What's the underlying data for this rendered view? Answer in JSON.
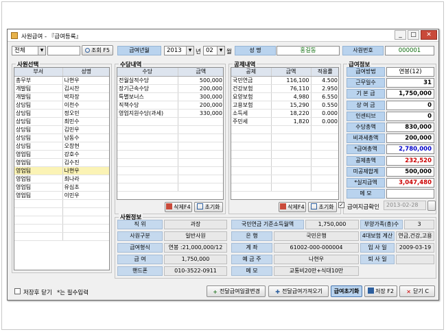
{
  "window": {
    "title": "사원급여 - 『급여등록』",
    "btn_min": "_",
    "btn_max": "□",
    "btn_close": "✕"
  },
  "toolbar": {
    "dept_combo": "전체",
    "search_text": "",
    "lookup_btn": "조회 F5",
    "ym_label": "급여년월",
    "year": "2013",
    "year_suffix": "년",
    "month": "02",
    "month_suffix": "월",
    "name_label": "성     명",
    "name_value": "홍길동",
    "empno_label": "사원번호",
    "empno_value": "000001"
  },
  "employees": {
    "title": "사원선택",
    "headers": [
      "부서",
      "성명"
    ],
    "rows": [
      [
        "총무부",
        "나현우"
      ],
      [
        "개발팀",
        "김시찬"
      ],
      [
        "개발팀",
        "박차장"
      ],
      [
        "상담팀",
        "이천수"
      ],
      [
        "상담팀",
        "정오민"
      ],
      [
        "상담팀",
        "최민수"
      ],
      [
        "상담팀",
        "김민우"
      ],
      [
        "상담팀",
        "남동수"
      ],
      [
        "상담팀",
        "오창현"
      ],
      [
        "영업팀",
        "강호수"
      ],
      [
        "영업팀",
        "김수진"
      ],
      [
        "영업팀",
        "나현우"
      ],
      [
        "영업팀",
        "최나라"
      ],
      [
        "영업팀",
        "유심초"
      ],
      [
        "영업팀",
        "이민우"
      ]
    ],
    "selected_index": 11
  },
  "allowance": {
    "title": "수당내역",
    "headers": [
      "수당",
      "금액"
    ],
    "rows": [
      [
        "전월실적수당",
        "500,000"
      ],
      [
        "장기근속수당",
        "200,000"
      ],
      [
        "특별보너스",
        "300,000"
      ],
      [
        "직책수당",
        "200,000"
      ],
      [
        "영업지원수당(과세)",
        "330,000"
      ]
    ],
    "delete_btn": "삭제F4",
    "reset_btn": "초기화"
  },
  "deduction": {
    "title": "공제내역",
    "headers": [
      "공제",
      "금액",
      "적용률"
    ],
    "rows": [
      [
        "국민연금",
        "116,100",
        "4.500"
      ],
      [
        "건강보험",
        "76,110",
        "2.950"
      ],
      [
        "요양보험",
        "4,980",
        "6.550"
      ],
      [
        "고용보험",
        "15,290",
        "0.550"
      ],
      [
        "소득세",
        "18,220",
        "0.000"
      ],
      [
        "주민세",
        "1,820",
        "0.000"
      ]
    ],
    "delete_btn": "삭제F4",
    "reset_btn": "초기화"
  },
  "pay_info": {
    "title": "급여정보",
    "items": [
      {
        "label": "급여방법",
        "value": "연봉(12)"
      },
      {
        "label": "근무일수",
        "value": "31"
      },
      {
        "label": "기 본 급",
        "value": "1,750,000"
      },
      {
        "label": "상 여 금",
        "value": "0"
      },
      {
        "label": "인센티브",
        "value": "0"
      },
      {
        "label": "수당총액",
        "value": "830,000"
      },
      {
        "label": "비과세총액",
        "value": "200,000"
      },
      {
        "label": "*급여총액",
        "value": "2,780,000"
      },
      {
        "label": "공제총액",
        "value": "232,520"
      },
      {
        "label": "미공제합계",
        "value": "500,000"
      },
      {
        "label": "*실지급액",
        "value": "3,047,480"
      },
      {
        "label": "메     모",
        "value": ""
      }
    ],
    "paid_check_label": "급여지급확인",
    "paid_date": "2013-02-28"
  },
  "employee_info": {
    "title": "사원정보",
    "position_label": "직     위",
    "position_value": "과장",
    "pension_label": "국민연금 기준소득월액",
    "pension_value": "1,750,000",
    "dependents_label": "부양가족(총)수",
    "dependents_value": "3",
    "class_label": "사원구분",
    "class_value": "일반사원",
    "bank_label": "은     행",
    "bank_value": "국민은행",
    "insurance_label": "4대보험 계산",
    "insurance_value": "연금,건강,고용",
    "paytype_label": "급여형식",
    "paytype_value": "연봉 :21,000,000/12",
    "account_label": "계     좌",
    "account_value": "61002-000-000004",
    "hire_label": "입 사 일",
    "hire_value": "2009-03-19",
    "salary_label": "급     여",
    "salary_value": "1,750,000",
    "holder_label": "예 금 주",
    "holder_value": "나현우",
    "leave_label": "퇴 사 일",
    "leave_value": "",
    "phone_label": "핸드폰",
    "phone_value": "010-3522-0911",
    "memo_label": "메     모",
    "memo_value": "교통비20만+식대10만"
  },
  "footer": {
    "close_after_save": "저장후 닫기",
    "required_note": "*는 필수입력",
    "prev_change_btn": "전달급여일괄변경",
    "prev_load_btn": "전달급여가져오기",
    "init_btn": "급여초기화",
    "save_btn": "저장 F2",
    "close_btn": "닫기 C"
  },
  "colors": {
    "label_blue": "#b9d3ee",
    "highlight_blue": "#0000c8",
    "highlight_red": "#cc0000",
    "selected_row": "#fbf3b5"
  }
}
